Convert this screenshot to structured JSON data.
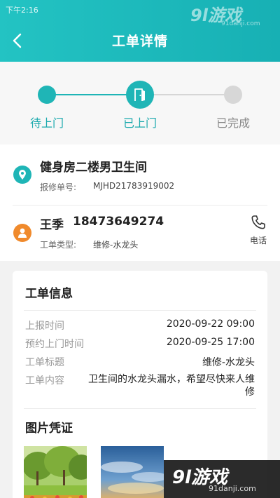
{
  "status_bar": {
    "time": "下午2:16"
  },
  "header": {
    "title": "工单详情"
  },
  "watermark": {
    "brand": "9l游戏",
    "site": "91danji.com"
  },
  "steps": [
    {
      "label": "待上门",
      "state": "done"
    },
    {
      "label": "已上门",
      "state": "current"
    },
    {
      "label": "已完成",
      "state": "pending"
    }
  ],
  "location": {
    "title": "健身房二楼男卫生间",
    "repair_no_label": "报修单号:",
    "repair_no": "MJHD21783919002"
  },
  "contact": {
    "name": "王季",
    "phone": "18473649274",
    "type_label": "工单类型:",
    "type_value": "维修-水龙头",
    "call_label": "电话"
  },
  "work_order": {
    "title": "工单信息",
    "fields": [
      {
        "label": "上报时间",
        "value": "2020-09-22 09:00"
      },
      {
        "label": "预约上门时间",
        "value": "2020-09-25 17:00"
      },
      {
        "label": "工单标题",
        "value": "维修-水龙头"
      },
      {
        "label": "工单内容",
        "value": "卫生间的水龙头漏水，希望尽快来人维修"
      }
    ]
  },
  "photos": {
    "title": "图片凭证"
  },
  "colors": {
    "accent": "#1fb5b6",
    "orange": "#f08a2c",
    "inactive": "#d7d7d7"
  },
  "icons": {
    "back": "chevron-left-icon",
    "door": "door-icon",
    "location": "location-pin-icon",
    "person": "person-icon",
    "phone": "phone-icon"
  }
}
